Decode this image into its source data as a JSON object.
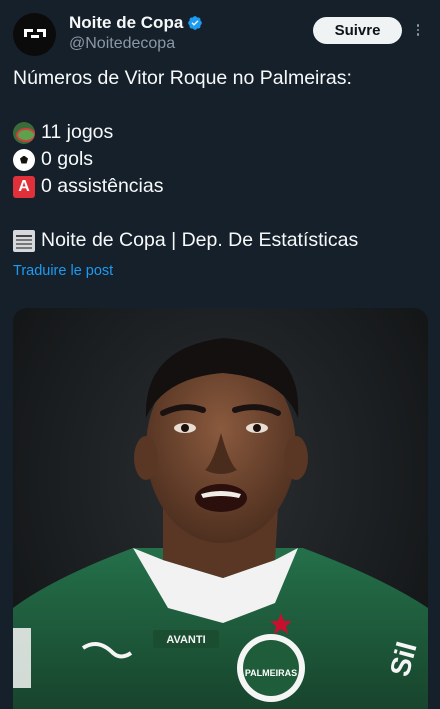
{
  "header": {
    "name": "Noite de Copa",
    "handle": "@Noitedecopa",
    "follow_label": "Suivre",
    "verified": true,
    "avatar_icon": "noite-de-copa-logo-icon",
    "more_icon": "more-vertical-icon"
  },
  "tweet": {
    "line1": "Números de Vitor Roque no Palmeiras:",
    "stat1_icon": "stadium-emoji",
    "stat1": "11 jogos",
    "stat2_icon": "soccer-ball-emoji",
    "stat2": "0 gols",
    "stat3_icon": "a-button-emoji",
    "stat3": "0 assistências",
    "signature_icon": "newspaper-emoji",
    "signature": "Noite de Copa | Dep. De Estatísticas",
    "translate_label": "Traduire le post"
  },
  "media": {
    "jersey_sponsor": "AVANTI",
    "crest_text": "PALMEIRAS",
    "sleeve_text": "Sil"
  },
  "colors": {
    "background": "#15202b",
    "text": "#f7f9f9",
    "secondary": "#8b98a5",
    "link": "#1d9bf0",
    "verified": "#1d9bf0",
    "jersey": "#1f5c3a"
  }
}
